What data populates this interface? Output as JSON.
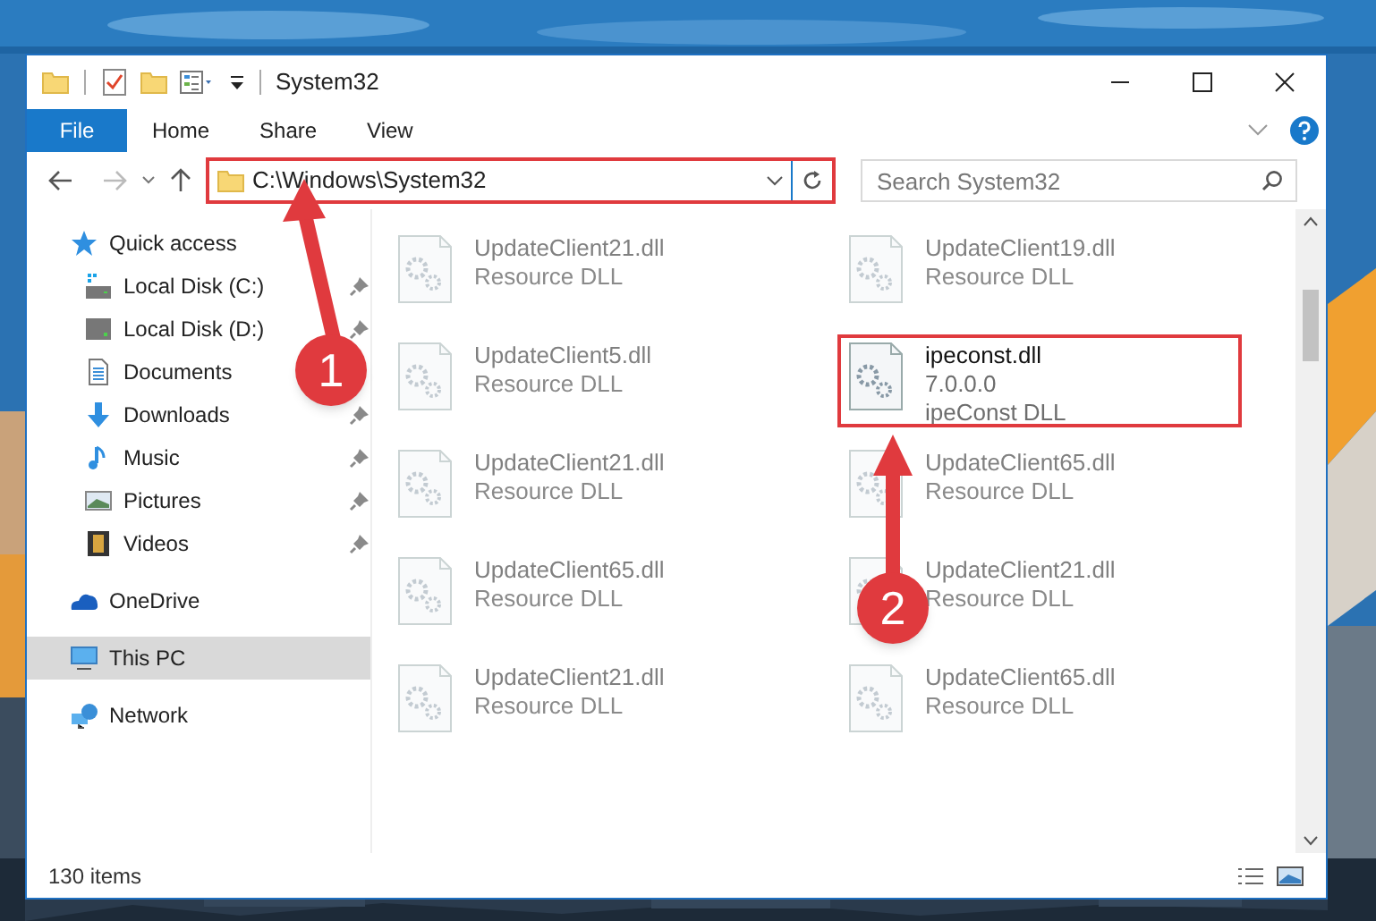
{
  "window": {
    "title": "System32"
  },
  "ribbon_tabs": [
    {
      "label": "File",
      "kind": "file"
    },
    {
      "label": "Home",
      "kind": "tab"
    },
    {
      "label": "Share",
      "kind": "tab"
    },
    {
      "label": "View",
      "kind": "tab"
    }
  ],
  "address_bar": {
    "path": "C:\\Windows\\System32",
    "highlighted": true
  },
  "search": {
    "placeholder": "Search System32"
  },
  "navigation": [
    {
      "label": "Quick access",
      "kind": "star",
      "selected": false,
      "children": [
        {
          "label": "Local Disk (C:)",
          "kind": "system-drive",
          "pinned": true,
          "selected": false
        },
        {
          "label": "Local Disk (D:)",
          "kind": "drive",
          "pinned": true,
          "selected": false
        },
        {
          "label": "Documents",
          "kind": "documents",
          "pinned": false,
          "selected": false
        },
        {
          "label": "Downloads",
          "kind": "downloads",
          "pinned": true,
          "selected": false
        },
        {
          "label": "Music",
          "kind": "music",
          "pinned": true,
          "selected": false
        },
        {
          "label": "Pictures",
          "kind": "pictures",
          "pinned": true,
          "selected": false
        },
        {
          "label": "Videos",
          "kind": "videos",
          "pinned": true,
          "selected": false
        }
      ]
    },
    {
      "label": "OneDrive",
      "kind": "cloud",
      "selected": false
    },
    {
      "label": "This PC",
      "kind": "computer",
      "selected": true
    },
    {
      "label": "Network",
      "kind": "network",
      "selected": false
    }
  ],
  "files": [
    {
      "name": "UpdateClient21.dll",
      "description": "Resource DLL",
      "blurred": true,
      "highlighted": false
    },
    {
      "name": "UpdateClient19.dll",
      "description": "Resource DLL",
      "blurred": true,
      "highlighted": false
    },
    {
      "name": "UpdateClient5.dll",
      "description": "Resource DLL",
      "blurred": true,
      "highlighted": false
    },
    {
      "name": "ipeconst.dll",
      "version": "7.0.0.0",
      "description": "ipeConst DLL",
      "blurred": false,
      "highlighted": true
    },
    {
      "name": "UpdateClient21.dll",
      "description": "Resource DLL",
      "blurred": true,
      "highlighted": false
    },
    {
      "name": "UpdateClient65.dll",
      "description": "Resource DLL",
      "blurred": true,
      "highlighted": false
    },
    {
      "name": "UpdateClient65.dll",
      "description": "Resource DLL",
      "blurred": true,
      "highlighted": false
    },
    {
      "name": "UpdateClient21.dll",
      "description": "Resource DLL",
      "blurred": true,
      "highlighted": false
    },
    {
      "name": "UpdateClient21.dll",
      "description": "Resource DLL",
      "blurred": true,
      "highlighted": false
    },
    {
      "name": "UpdateClient65.dll",
      "description": "Resource DLL",
      "blurred": true,
      "highlighted": false
    }
  ],
  "status_bar": {
    "item_count": "130 items"
  },
  "annotations": [
    {
      "number": "1"
    },
    {
      "number": "2"
    }
  ]
}
